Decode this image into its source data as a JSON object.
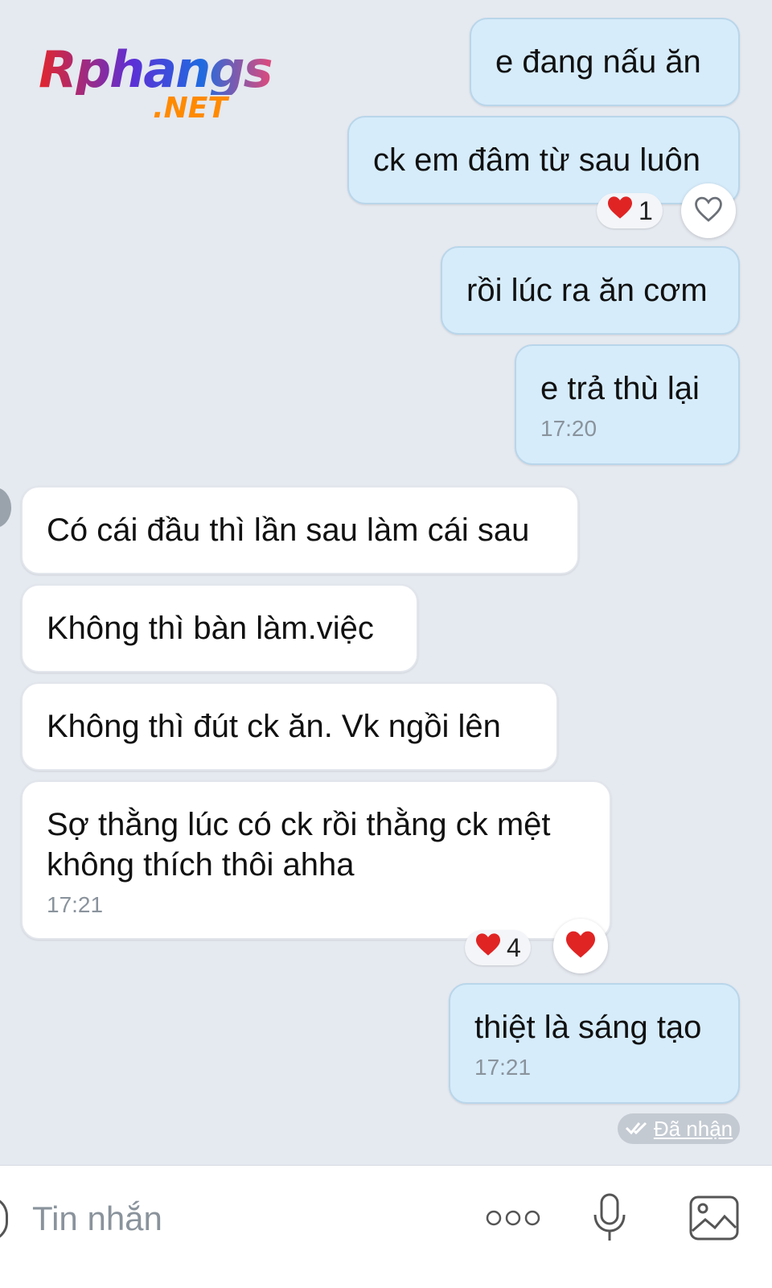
{
  "watermark": {
    "main": "Rphangs",
    "sub": ".NET"
  },
  "messages": [
    {
      "text": "e đang nấu ăn"
    },
    {
      "text": "ck em đâm từ sau luôn",
      "reaction_count": "1"
    },
    {
      "text": "rồi lúc ra ăn cơm"
    },
    {
      "text": "e trả thù lại",
      "time": "17:20"
    },
    {
      "text": "Có cái đầu thì lần sau làm cái sau"
    },
    {
      "text": "Không thì bàn làm.việc"
    },
    {
      "text": "Không thì đút ck ăn. Vk ngồi lên"
    },
    {
      "text": "Sợ thằng lúc có ck rồi thằng ck mệt không thích thôi ahha",
      "time": "17:21",
      "reaction_count": "4"
    },
    {
      "text": "thiệt là sáng tạo",
      "time": "17:21"
    }
  ],
  "status": {
    "received": "Đã nhận"
  },
  "composer": {
    "placeholder": "Tin nhắn"
  },
  "colors": {
    "heart": "#e02424",
    "sent_bubble": "#d6ecfb",
    "received_bubble": "#ffffff",
    "background": "#e5e9f0"
  }
}
